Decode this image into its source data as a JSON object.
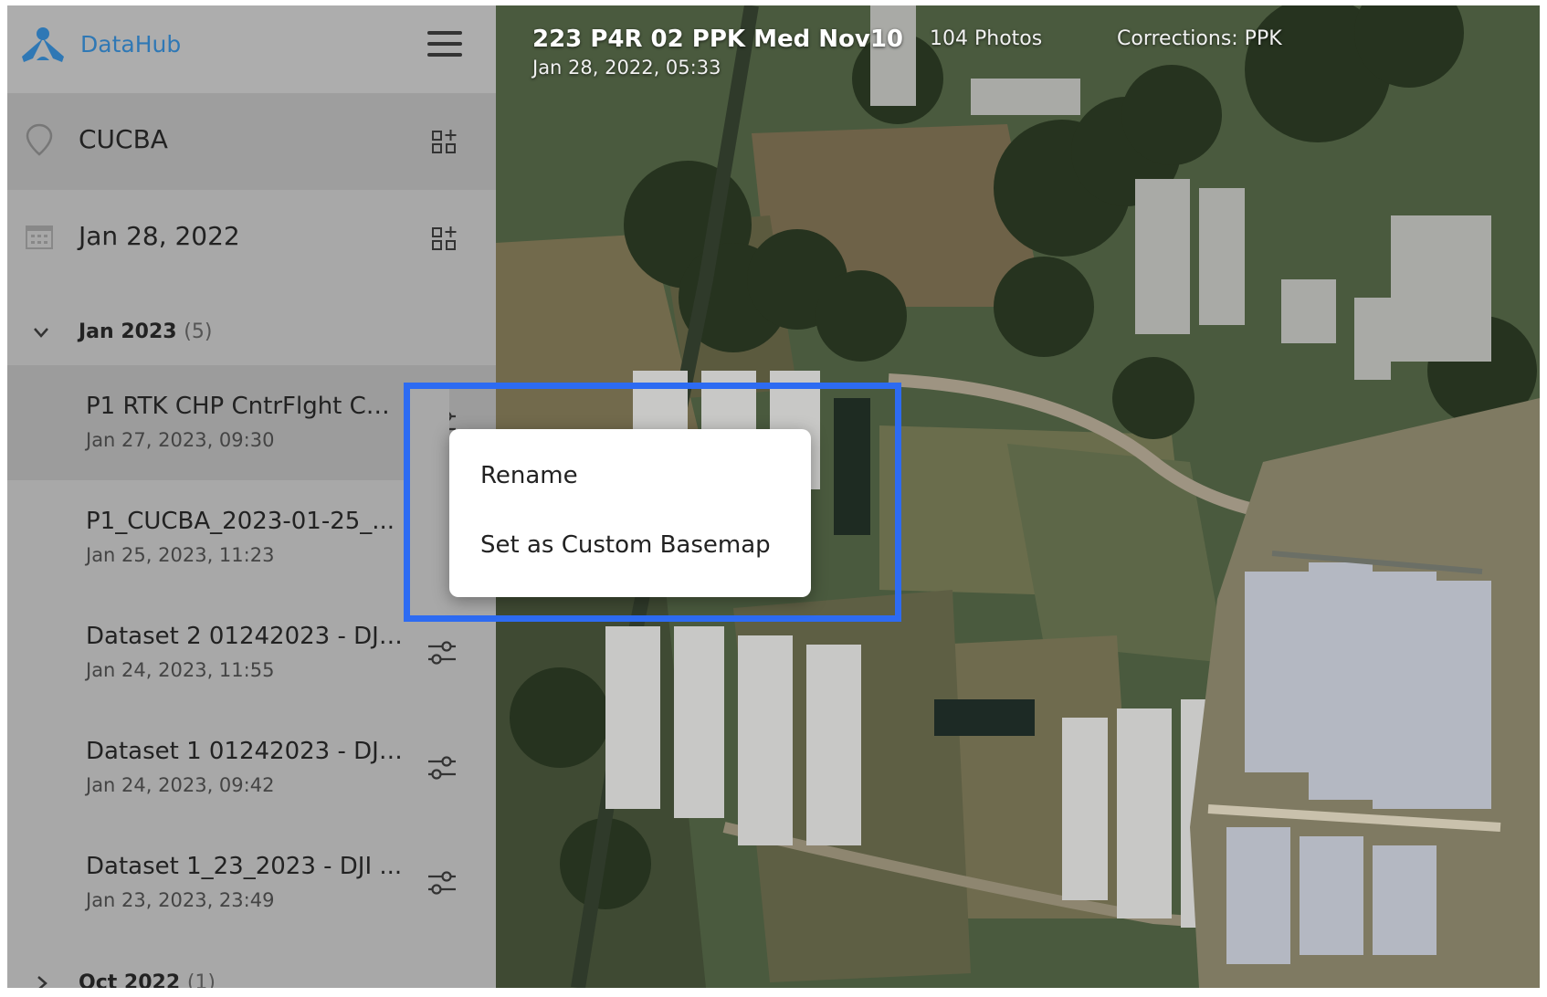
{
  "brand": {
    "name": "DataHub",
    "accent": "#2f78b5"
  },
  "filters": {
    "site": {
      "label": "CUCBA",
      "icon": "location-pin-icon"
    },
    "date": {
      "label": "Jan 28, 2022",
      "icon": "calendar-icon"
    }
  },
  "groups": {
    "jan": {
      "label": "Jan 2023",
      "count": "(5)",
      "expanded": true
    },
    "oct": {
      "label": "Oct 2022",
      "count": "(1)",
      "expanded": false
    }
  },
  "datasets": [
    {
      "name": "P1 RTK CHP CntrFlght CU...",
      "date": "Jan 27, 2023, 09:30",
      "selected": true
    },
    {
      "name": "P1_CUCBA_2023-01-25_...",
      "date": "Jan 25, 2023, 11:23",
      "selected": false
    },
    {
      "name": "Dataset 2 01242023 - DJI ...",
      "date": "Jan 24, 2023, 11:55",
      "selected": false
    },
    {
      "name": "Dataset 1 01242023 - DJI ...",
      "date": "Jan 24, 2023, 09:42",
      "selected": false
    },
    {
      "name": "Dataset 1_23_2023 - DJI ...",
      "date": "Jan 23, 2023, 23:49",
      "selected": false
    }
  ],
  "map": {
    "title": "223 P4R 02 PPK Med Nov10",
    "subtitle": "Jan 28, 2022, 05:33",
    "photos": "104 Photos",
    "corrections": "Corrections: PPK"
  },
  "context_menu": {
    "items": [
      "Rename",
      "Set as Custom Basemap"
    ],
    "highlight_color": "#2d6bf2"
  }
}
